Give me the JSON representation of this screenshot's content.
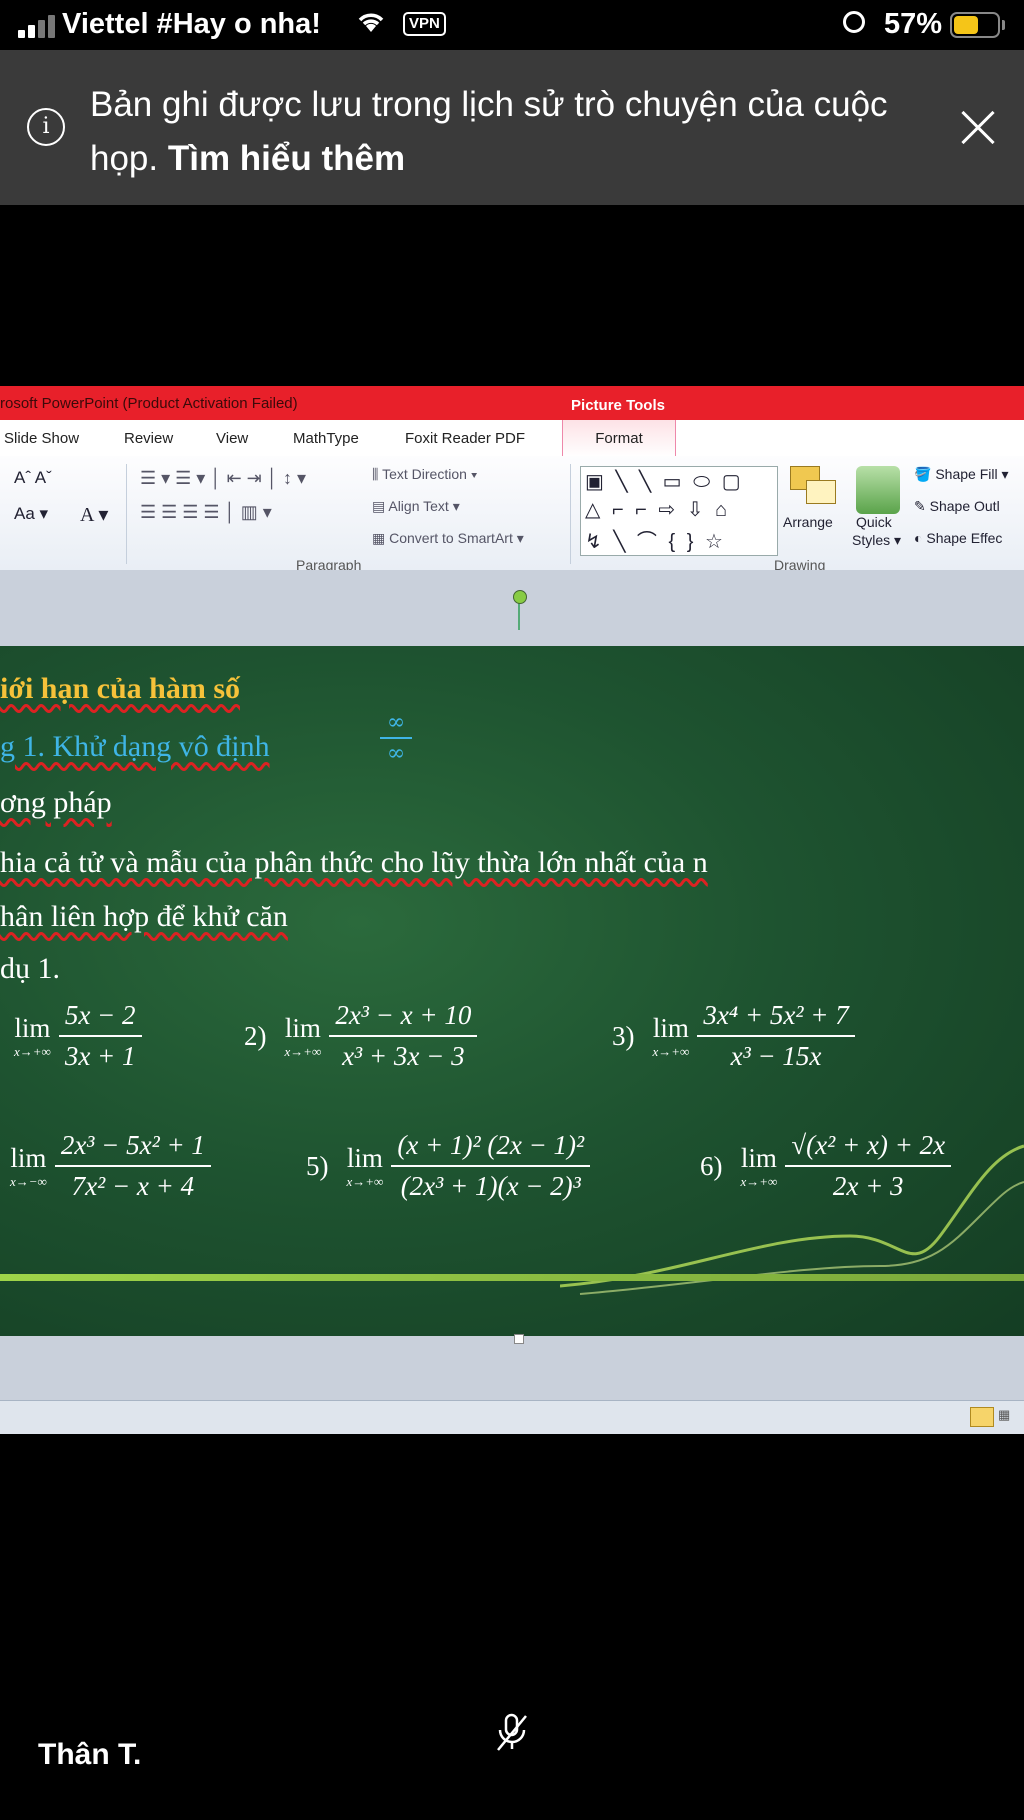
{
  "status_bar": {
    "carrier": "Viettel #Hay o nha!",
    "vpn": "VPN",
    "battery_pct": "57%",
    "battery_level": 0.57
  },
  "banner": {
    "message": "Bản ghi được lưu trong lịch sử trò chuyện của cuộc họp.",
    "link": "Tìm hiểu thêm"
  },
  "ppt": {
    "title": "rosoft PowerPoint (Product Activation Failed)",
    "context_tab": "Picture Tools",
    "tabs": [
      "Slide Show",
      "Review",
      "View",
      "MathType",
      "Foxit Reader PDF"
    ],
    "format_tab": "Format",
    "ribbon": {
      "text_direction": "Text Direction",
      "align_text": "Align Text",
      "convert_smartart": "Convert to SmartArt",
      "paragraph": "Paragraph",
      "drawing": "Drawing",
      "arrange": "Arrange",
      "quick_styles_1": "Quick",
      "quick_styles_2": "Styles",
      "shape_fill": "Shape Fill",
      "shape_outline": "Shape Outl",
      "shape_effects": "Shape Effec"
    }
  },
  "slide": {
    "heading": "iới hạn của hàm số",
    "sub": "g 1. Khử dạng vô định",
    "inf_symbol": "∞",
    "method": "ơng pháp",
    "line1": "hia cả tử và mẫu của phân thức cho lũy thừa lớn nhất của n",
    "line2": "hân liên hợp để khử căn",
    "example": "dụ 1.",
    "lim": "lim",
    "problems": [
      {
        "n": "",
        "sub": "x→+∞",
        "num": "5x − 2",
        "den": "3x + 1"
      },
      {
        "n": "2)",
        "sub": "x→+∞",
        "num": "2x³ − x + 10",
        "den": "x³ + 3x − 3"
      },
      {
        "n": "3)",
        "sub": "x→+∞",
        "num": "3x⁴ + 5x² + 7",
        "den": "x³ − 15x"
      },
      {
        "n": "",
        "sub": "x→−∞",
        "num": "2x³ − 5x² + 1",
        "den": "7x² − x + 4"
      },
      {
        "n": "5)",
        "sub": "x→+∞",
        "num": "(x + 1)² (2x − 1)²",
        "den": "(2x³ + 1)(x − 2)³"
      },
      {
        "n": "6)",
        "sub": "x→+∞",
        "num": "√(x² + x) + 2x",
        "den": "2x + 3"
      }
    ]
  },
  "participant": {
    "name": "Thân T."
  }
}
